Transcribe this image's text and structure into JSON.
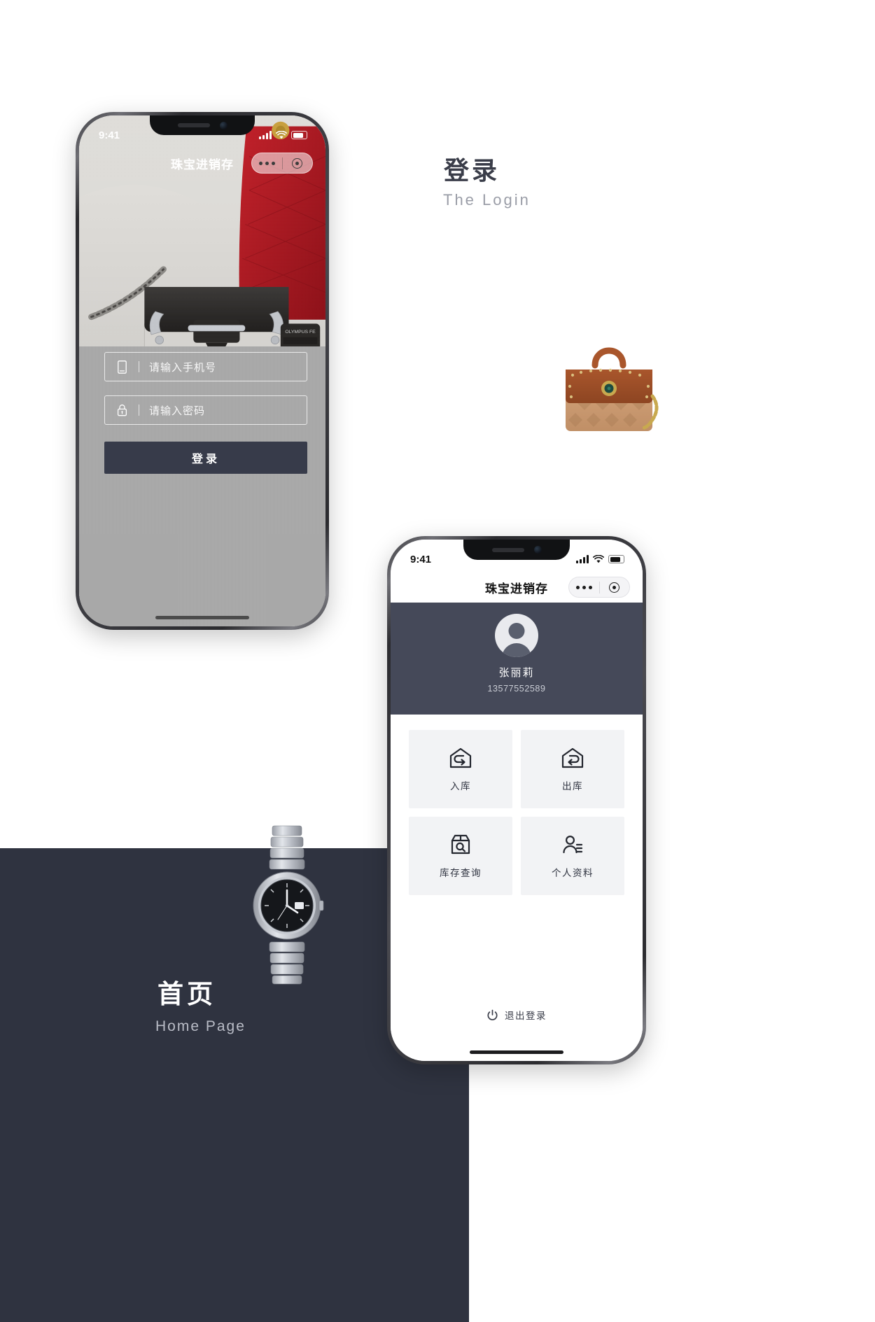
{
  "sections": {
    "login": {
      "title": "登录",
      "subtitle": "The Login"
    },
    "home": {
      "title": "首页",
      "subtitle": "Home Page"
    }
  },
  "login_screen": {
    "status": {
      "time": "9:41",
      "signal_icon": "signal-bars-icon",
      "wifi_icon": "wifi-icon",
      "battery_icon": "battery-icon"
    },
    "nav": {
      "title": "珠宝进销存",
      "more_icon": "more-dots-icon",
      "target_icon": "target-circle-icon"
    },
    "phone_field": {
      "icon": "mobile-phone-icon",
      "placeholder": "请输入手机号",
      "value": ""
    },
    "password_field": {
      "icon": "lock-icon",
      "placeholder": "请输入密码",
      "value": ""
    },
    "submit_label": "登录"
  },
  "home_screen": {
    "status": {
      "time": "9:41",
      "signal_icon": "signal-bars-icon",
      "wifi_icon": "wifi-icon",
      "battery_icon": "battery-icon"
    },
    "nav": {
      "title": "珠宝进销存",
      "more_icon": "more-dots-icon",
      "target_icon": "target-circle-icon"
    },
    "profile": {
      "avatar_icon": "user-avatar-icon",
      "name": "张丽莉",
      "phone": "13577552589"
    },
    "menu": [
      {
        "label": "入库",
        "icon": "warehouse-in-icon"
      },
      {
        "label": "出库",
        "icon": "warehouse-out-icon"
      },
      {
        "label": "库存查询",
        "icon": "box-search-icon"
      },
      {
        "label": "个人资料",
        "icon": "user-profile-icon"
      }
    ],
    "logout": {
      "label": "退出登录",
      "icon": "power-icon"
    }
  },
  "colors": {
    "dark_band": "#2f3340",
    "profile_panel": "#454959",
    "button": "#373b4a",
    "tile_bg": "#f2f3f5",
    "login_overlay": "#a9a9a9"
  }
}
